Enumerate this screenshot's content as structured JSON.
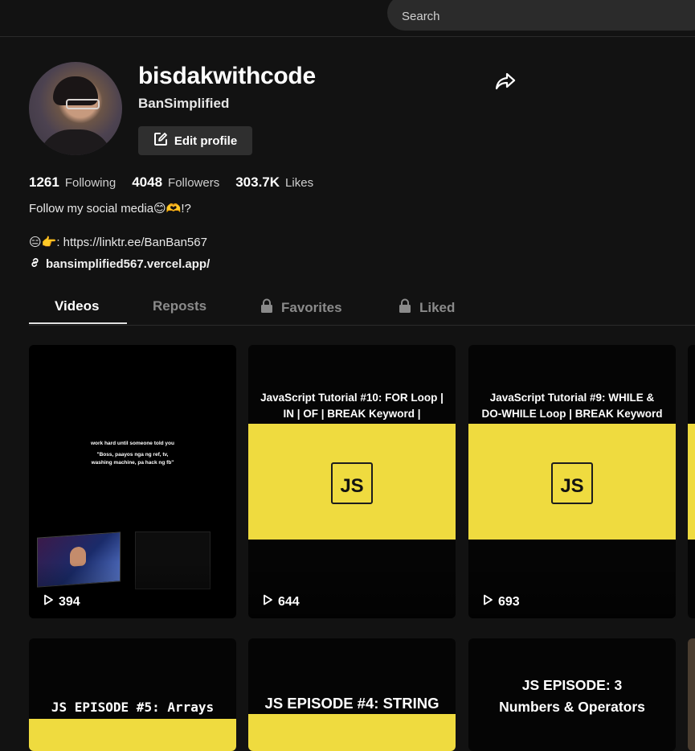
{
  "search": {
    "placeholder": "Search"
  },
  "profile": {
    "username": "bisdakwithcode",
    "nickname": "BanSimplified",
    "edit_label": "Edit profile",
    "stats": [
      {
        "value": "1261",
        "label": "Following"
      },
      {
        "value": "4048",
        "label": "Followers"
      },
      {
        "value": "303.7K",
        "label": "Likes"
      }
    ],
    "bio_line1": "Follow my social media😊🫶!?",
    "bio_line2": "😑👉: https://linktr.ee/BanBan567",
    "link": "bansimplified567.vercel.app/"
  },
  "tabs": [
    {
      "label": "Videos",
      "locked": false
    },
    {
      "label": "Reposts",
      "locked": false
    },
    {
      "label": "Favorites",
      "locked": true
    },
    {
      "label": "Liked",
      "locked": true
    }
  ],
  "videos": [
    {
      "caption_line1": "work hard until someone told you",
      "caption_line2": "\"Boss, paayos nga ng ref, tv,",
      "caption_line3": "washing machine, pa hack ng fb\"",
      "views": "394"
    },
    {
      "title_line1": "JavaScript Tutorial #10: FOR Loop |",
      "title_line2": "IN | OF | BREAK Keyword |",
      "logo": "JS",
      "views": "644"
    },
    {
      "title_line1": "JavaScript Tutorial #9: WHILE &",
      "title_line2": "DO-WHILE Loop | BREAK Keyword",
      "logo": "JS",
      "views": "693"
    },
    {
      "title_line1": "JS EPISODE #5: Arrays"
    },
    {
      "title_line1": "JS EPISODE #4: STRING"
    },
    {
      "title_line1": "JS EPISODE: 3",
      "title_line2": "Numbers & Operators"
    }
  ]
}
